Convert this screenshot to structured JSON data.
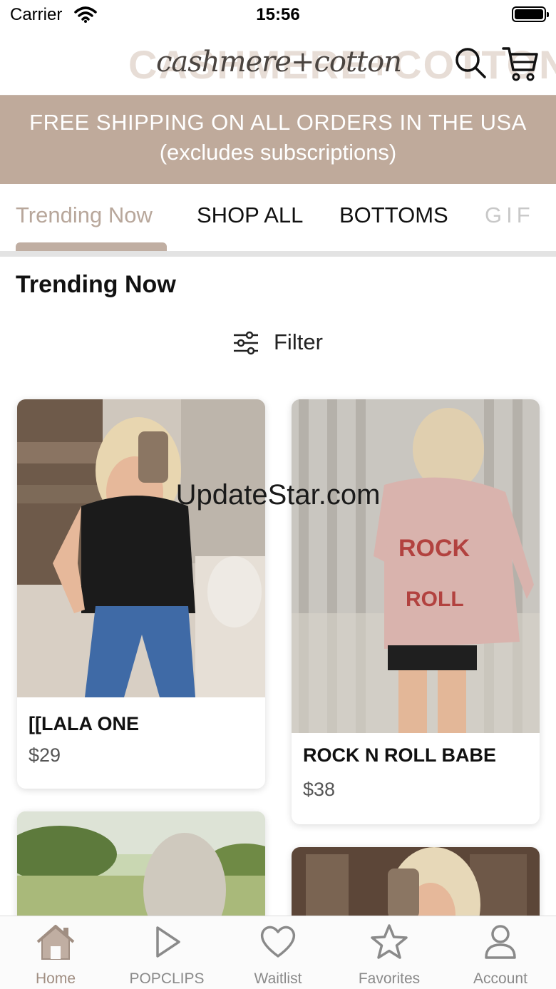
{
  "status_bar": {
    "carrier": "Carrier",
    "time": "15:56"
  },
  "header": {
    "logo_text": "CASHMERE+COTTON",
    "logo_script": "cashmere+cotton",
    "icons": [
      "search-icon",
      "cart-icon"
    ]
  },
  "promo": {
    "line1": "FREE SHIPPING ON ALL ORDERS IN THE USA",
    "line2": "(excludes subscriptions)",
    "background": "#bfaa9b"
  },
  "tabs": {
    "items": [
      {
        "label": "Trending Now",
        "active": true
      },
      {
        "label": "SHOP ALL",
        "active": false
      },
      {
        "label": "BOTTOMS",
        "active": false
      },
      {
        "label": "GIF",
        "active": false
      }
    ],
    "accent": "#c0aea2"
  },
  "section": {
    "title": "Trending Now",
    "filter_label": "Filter"
  },
  "products": [
    {
      "name": "[[LALA ONE",
      "price": "$29"
    },
    {
      "name": "ROCK N ROLL BABE",
      "price": "$38"
    }
  ],
  "watermark": "UpdateStar.com",
  "tabbar": {
    "items": [
      {
        "label": "Home",
        "icon": "home-icon",
        "active": true
      },
      {
        "label": "POPCLIPS",
        "icon": "play-icon",
        "active": false
      },
      {
        "label": "Waitlist",
        "icon": "heart-icon",
        "active": false
      },
      {
        "label": "Favorites",
        "icon": "star-icon",
        "active": false
      },
      {
        "label": "Account",
        "icon": "person-icon",
        "active": false
      }
    ]
  }
}
